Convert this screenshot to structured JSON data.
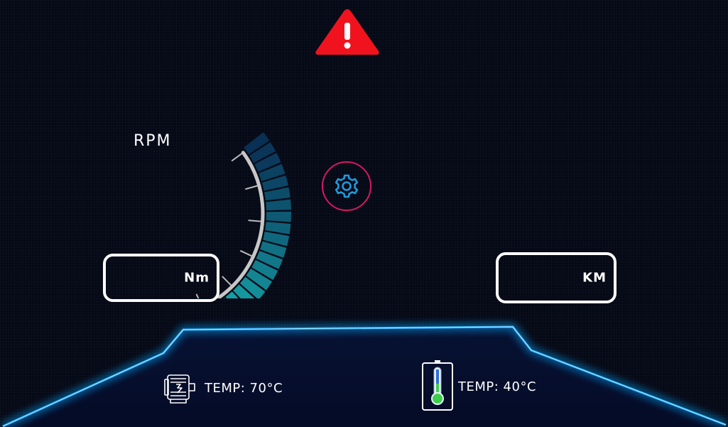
{
  "gauge": {
    "label": "RPM",
    "segment_count": 24,
    "color_start": "#0b4f86",
    "color_end": "#1fe6d3"
  },
  "torque": {
    "unit": "Nm",
    "value": ""
  },
  "distance": {
    "unit": "KM",
    "value": ""
  },
  "warning": {
    "icon": "warning-triangle-icon",
    "color": "#f0131e"
  },
  "settings": {
    "icon": "gear-icon",
    "ring_color": "#d7195f",
    "icon_color": "#1f9bdb"
  },
  "status_panel": {
    "glow_color": "#1aa8ff",
    "motor_temp": {
      "icon": "motor-icon",
      "label": "TEMP: 70°C"
    },
    "battery_temp": {
      "icon": "thermometer-icon",
      "label": "TEMP: 40°C",
      "level_color": "#3ecf4a"
    }
  }
}
